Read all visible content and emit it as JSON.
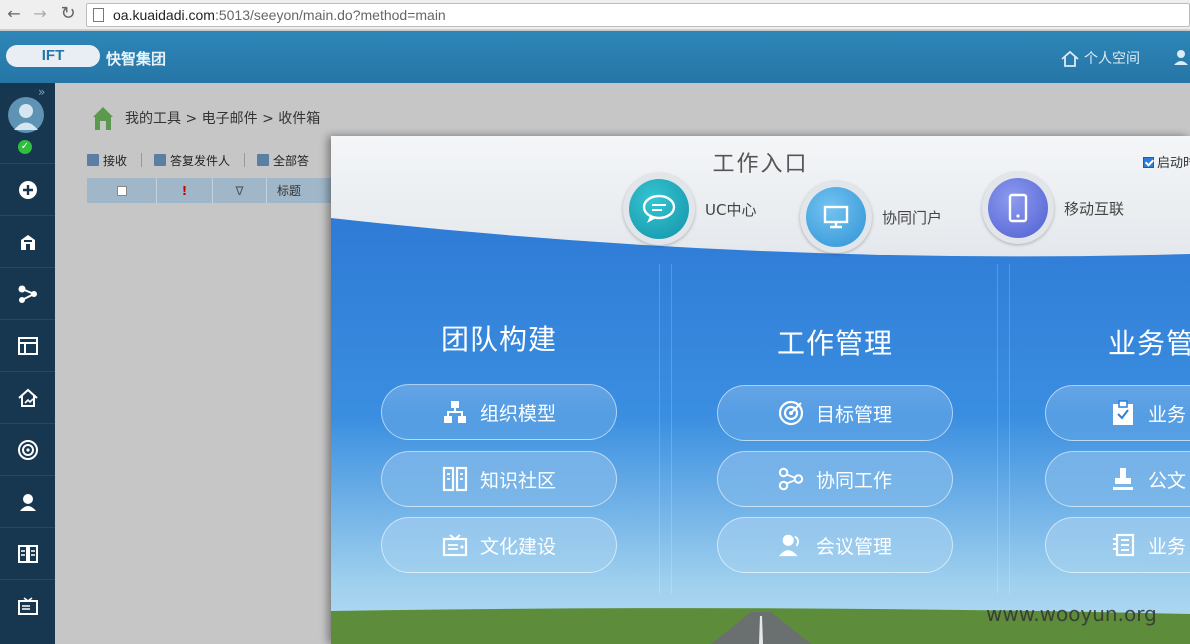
{
  "browser": {
    "url_host": "oa.kuaidadi.com",
    "url_path": ":5013/seeyon/main.do?method=main"
  },
  "header": {
    "logo_text": "IFT",
    "company": "快智集团",
    "personal_space": "个人空间"
  },
  "breadcrumb": {
    "text": "我的工具 > 电子邮件 > 收件箱"
  },
  "toolbar": {
    "receive": "接收",
    "reply_sender": "答复发件人",
    "reply_all": "全部答"
  },
  "mail_table": {
    "headers": [
      "",
      "!",
      "",
      "标题"
    ]
  },
  "modal": {
    "title": "工作入口",
    "startup_label": "启动时",
    "entries": [
      {
        "label": "UC中心",
        "color": "#1aa6b8"
      },
      {
        "label": "协同门户",
        "color": "#3aa0d8"
      },
      {
        "label": "移动互联",
        "color": "#5c6fd6"
      }
    ],
    "columns": [
      {
        "title": "团队构建",
        "buttons": [
          "组织模型",
          "知识社区",
          "文化建设"
        ]
      },
      {
        "title": "工作管理",
        "buttons": [
          "目标管理",
          "协同工作",
          "会议管理"
        ]
      },
      {
        "title": "业务管",
        "buttons": [
          "业务",
          "公文",
          "业务"
        ]
      }
    ]
  },
  "watermark": "www.wooyun.org",
  "colors": {
    "header_blue": "#2a80b2",
    "sidebar_navy": "#17364f",
    "modal_blue": "#2f7fd6"
  }
}
